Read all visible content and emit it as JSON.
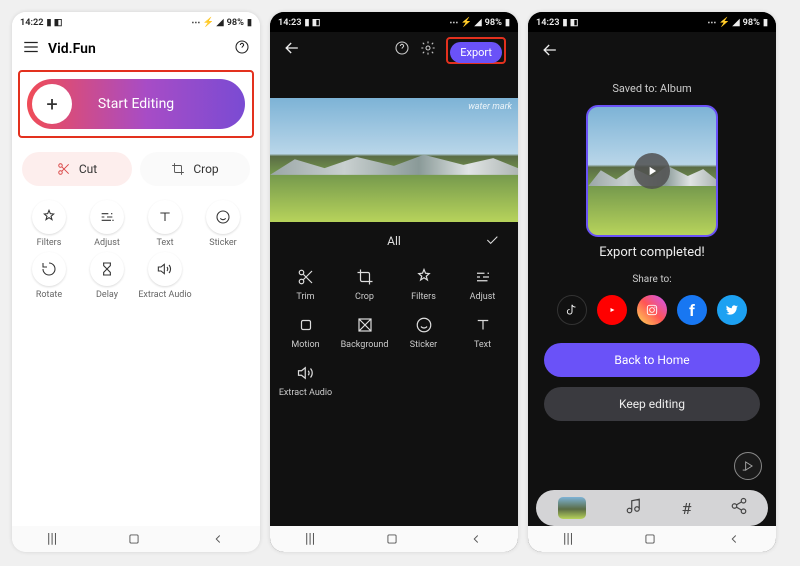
{
  "screen1": {
    "status": {
      "time": "14:22",
      "battery": "98%"
    },
    "app_title": "Vid.Fun",
    "start_editing": "Start Editing",
    "cut": "Cut",
    "crop": "Crop",
    "tools": {
      "filters": "Filters",
      "adjust": "Adjust",
      "text": "Text",
      "sticker": "Sticker",
      "rotate": "Rotate",
      "delay": "Delay",
      "extract_audio": "Extract Audio"
    }
  },
  "screen2": {
    "status": {
      "time": "14:23",
      "battery": "98%"
    },
    "export": "Export",
    "watermark": "water mark",
    "tab_all": "All",
    "tools": {
      "trim": "Trim",
      "crop": "Crop",
      "filters": "Filters",
      "adjust": "Adjust",
      "motion": "Motion",
      "background": "Background",
      "sticker": "Sticker",
      "text": "Text",
      "extract_audio": "Extract Audio"
    }
  },
  "screen3": {
    "status": {
      "time": "14:23",
      "battery": "98%"
    },
    "saved_to": "Saved to: Album",
    "export_completed": "Export completed!",
    "share_to": "Share to:",
    "back_to_home": "Back to Home",
    "keep_editing": "Keep editing"
  }
}
